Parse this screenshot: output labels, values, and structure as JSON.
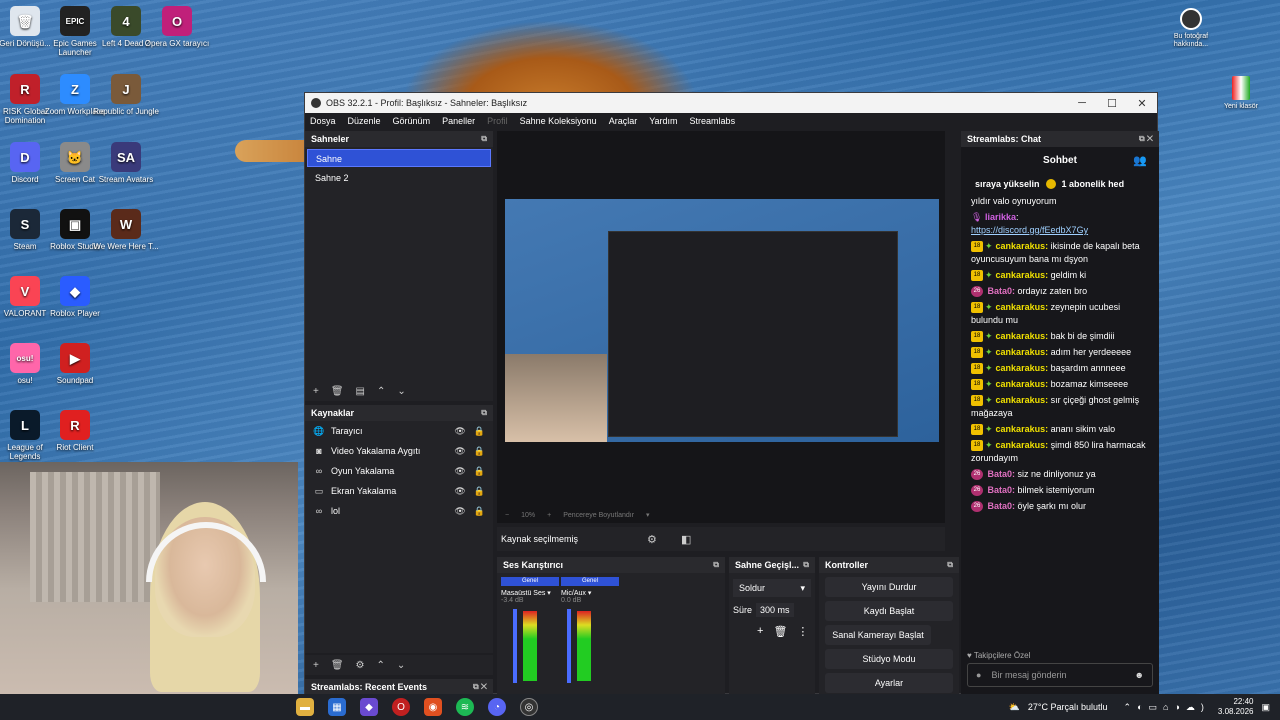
{
  "desktop": {
    "icons_left": [
      {
        "label": "Geri Dönüşü...",
        "icon": "recycle-bin-icon",
        "color": "#dfe6ee",
        "glyph": "🗑"
      },
      {
        "label": "Epic Games Launcher",
        "icon": "epic-games-icon",
        "color": "#222222",
        "glyph": "EPIC"
      },
      {
        "label": "Left 4 Dead 2",
        "icon": "left4dead-icon",
        "color": "#3a4a2a",
        "glyph": "4"
      },
      {
        "label": "RISK Global Domination",
        "icon": "risk-icon",
        "color": "#c0202a",
        "glyph": "R"
      },
      {
        "label": "Zoom Workplace",
        "icon": "zoom-icon",
        "color": "#2d8cff",
        "glyph": "Z"
      },
      {
        "label": "Republic of Jungle",
        "icon": "republic-jungle-icon",
        "color": "#7a5a3a",
        "glyph": "J"
      },
      {
        "label": "Opera GX tarayıcı",
        "icon": "opera-gx-icon",
        "color": "#c0207a",
        "glyph": "O"
      },
      {
        "label": "Discord",
        "icon": "discord-icon",
        "color": "#5865f2",
        "glyph": "D"
      },
      {
        "label": "Screen Cat",
        "icon": "screen-cat-icon",
        "color": "#8a8a8a",
        "glyph": "🐱"
      },
      {
        "label": "Stream Avatars",
        "icon": "stream-avatars-icon",
        "color": "#3a3a7a",
        "glyph": "SA"
      },
      {
        "label": "Steam",
        "icon": "steam-icon",
        "color": "#1b2838",
        "glyph": "S"
      },
      {
        "label": "Roblox Studio",
        "icon": "roblox-studio-icon",
        "color": "#111111",
        "glyph": "▣"
      },
      {
        "label": "We Were Here T...",
        "icon": "we-were-here-icon",
        "color": "#5a2a1a",
        "glyph": "W"
      },
      {
        "label": "VALORANT",
        "icon": "valorant-icon",
        "color": "#fa4454",
        "glyph": "V"
      },
      {
        "label": "Roblox Player",
        "icon": "roblox-player-icon",
        "color": "#2a5cff",
        "glyph": "◆"
      },
      {
        "label": "osu!",
        "icon": "osu-icon",
        "color": "#ff66aa",
        "glyph": "osu!"
      },
      {
        "label": "Soundpad",
        "icon": "soundpad-icon",
        "color": "#d02020",
        "glyph": "▶"
      },
      {
        "label": "League of Legends",
        "icon": "league-icon",
        "color": "#0a1a2a",
        "glyph": "L"
      },
      {
        "label": "Riot Client",
        "icon": "riot-client-icon",
        "color": "#e02020",
        "glyph": "R"
      }
    ],
    "icons_right": [
      {
        "label": "Bu fotoğraf hakkında...",
        "icon": "camera-info-icon"
      },
      {
        "label": "Yeni klasör",
        "icon": "folder-icon"
      }
    ]
  },
  "obs": {
    "window_title": "OBS 32.2.1 - Profil: Başlıksız - Sahneler: Başlıksız",
    "menu": [
      "Dosya",
      "Düzenle",
      "Görünüm",
      "Paneller",
      "Profil",
      "Sahne Koleksiyonu",
      "Araçlar",
      "Yardım",
      "Streamlabs"
    ],
    "scenes": {
      "title": "Sahneler",
      "items": [
        "Sahne",
        "Sahne 2"
      ],
      "selected": 0
    },
    "sources": {
      "title": "Kaynaklar",
      "items": [
        {
          "label": "Tarayıcı",
          "icon": "globe-icon"
        },
        {
          "label": "Video Yakalama Aygıtı",
          "icon": "camera-icon"
        },
        {
          "label": "Oyun Yakalama",
          "icon": "gamepad-icon"
        },
        {
          "label": "Ekran Yakalama",
          "icon": "monitor-icon"
        },
        {
          "label": "lol",
          "icon": "gamepad-icon"
        }
      ]
    },
    "preview": {
      "zoom": "10%",
      "fit_label": "Pencereye Boyutlandır"
    },
    "source_props": {
      "label": "Kaynak seçilmemiş"
    },
    "mixer": {
      "title": "Ses Karıştırıcı",
      "channels": [
        {
          "tag": "Genel",
          "name": "Masaüstü Ses",
          "level": "-3.4 dB"
        },
        {
          "tag": "Genel",
          "name": "Mic/Aux",
          "level": "0.0 dB"
        }
      ]
    },
    "transitions": {
      "title": "Sahne Geçişl...",
      "type": "Soldur",
      "duration_label": "Süre",
      "duration": "300 ms"
    },
    "controls": {
      "title": "Kontroller",
      "buttons": [
        "Yayını Durdur",
        "Kaydı Başlat",
        "Sanal Kamerayı Başlat",
        "Stüdyo Modu",
        "Ayarlar"
      ]
    },
    "events_title": "Streamlabs: Recent Events",
    "chat": {
      "dock_title": "Streamlabs: Chat",
      "tab": "Sohbet",
      "top_text": "sıraya yükselin",
      "sub_text": "1 abonelik hed",
      "messages": [
        {
          "user": "",
          "text": "yıldır valo oynuyorum",
          "badge": "none"
        },
        {
          "user": "liarikka",
          "text": "https://discord.gg/fEedbX7Gy",
          "badge": "mic",
          "link": true
        },
        {
          "user": "cankarakus",
          "text": "ikisinde de kapalı beta oyuncusuyum bana mı dşyon",
          "badge": "sub"
        },
        {
          "user": "cankarakus",
          "text": "geldim ki",
          "badge": "sub"
        },
        {
          "user": "Bata0",
          "text": "ordayız zaten bro",
          "badge": "pink"
        },
        {
          "user": "cankarakus",
          "text": "zeynepin ucubesi bulundu mu",
          "badge": "sub"
        },
        {
          "user": "cankarakus",
          "text": "bak bi de şimdiii",
          "badge": "sub"
        },
        {
          "user": "cankarakus",
          "text": "adım her yerdeeeee",
          "badge": "sub"
        },
        {
          "user": "cankarakus",
          "text": "başardım annneee",
          "badge": "sub"
        },
        {
          "user": "cankarakus",
          "text": "bozamaz kimseeee",
          "badge": "sub"
        },
        {
          "user": "cankarakus",
          "text": "sır çiçeği ghost gelmiş mağazaya",
          "badge": "sub"
        },
        {
          "user": "cankarakus",
          "text": "ananı sikim valo",
          "badge": "sub"
        },
        {
          "user": "cankarakus",
          "text": "şimdi 850 lira harmacak zorundayım",
          "badge": "sub"
        },
        {
          "user": "Bata0",
          "text": "siz ne dinliyonuz ya",
          "badge": "pink"
        },
        {
          "user": "Bata0",
          "text": "bilmek istemiyorum",
          "badge": "pink"
        },
        {
          "user": "Bata0",
          "text": "öyle şarkı mı olur",
          "badge": "pink"
        }
      ],
      "followers_label": "Takipçilere Özel",
      "input_placeholder": "Bir mesaj gönderin"
    }
  },
  "taskbar": {
    "weather": "27°C  Parçalı bulutlu",
    "time": "22:40",
    "date": "3.08.2026"
  },
  "colors": {
    "accent": "#2f52d6",
    "sub_badge": "#f0c000",
    "username": "#f0e000"
  }
}
